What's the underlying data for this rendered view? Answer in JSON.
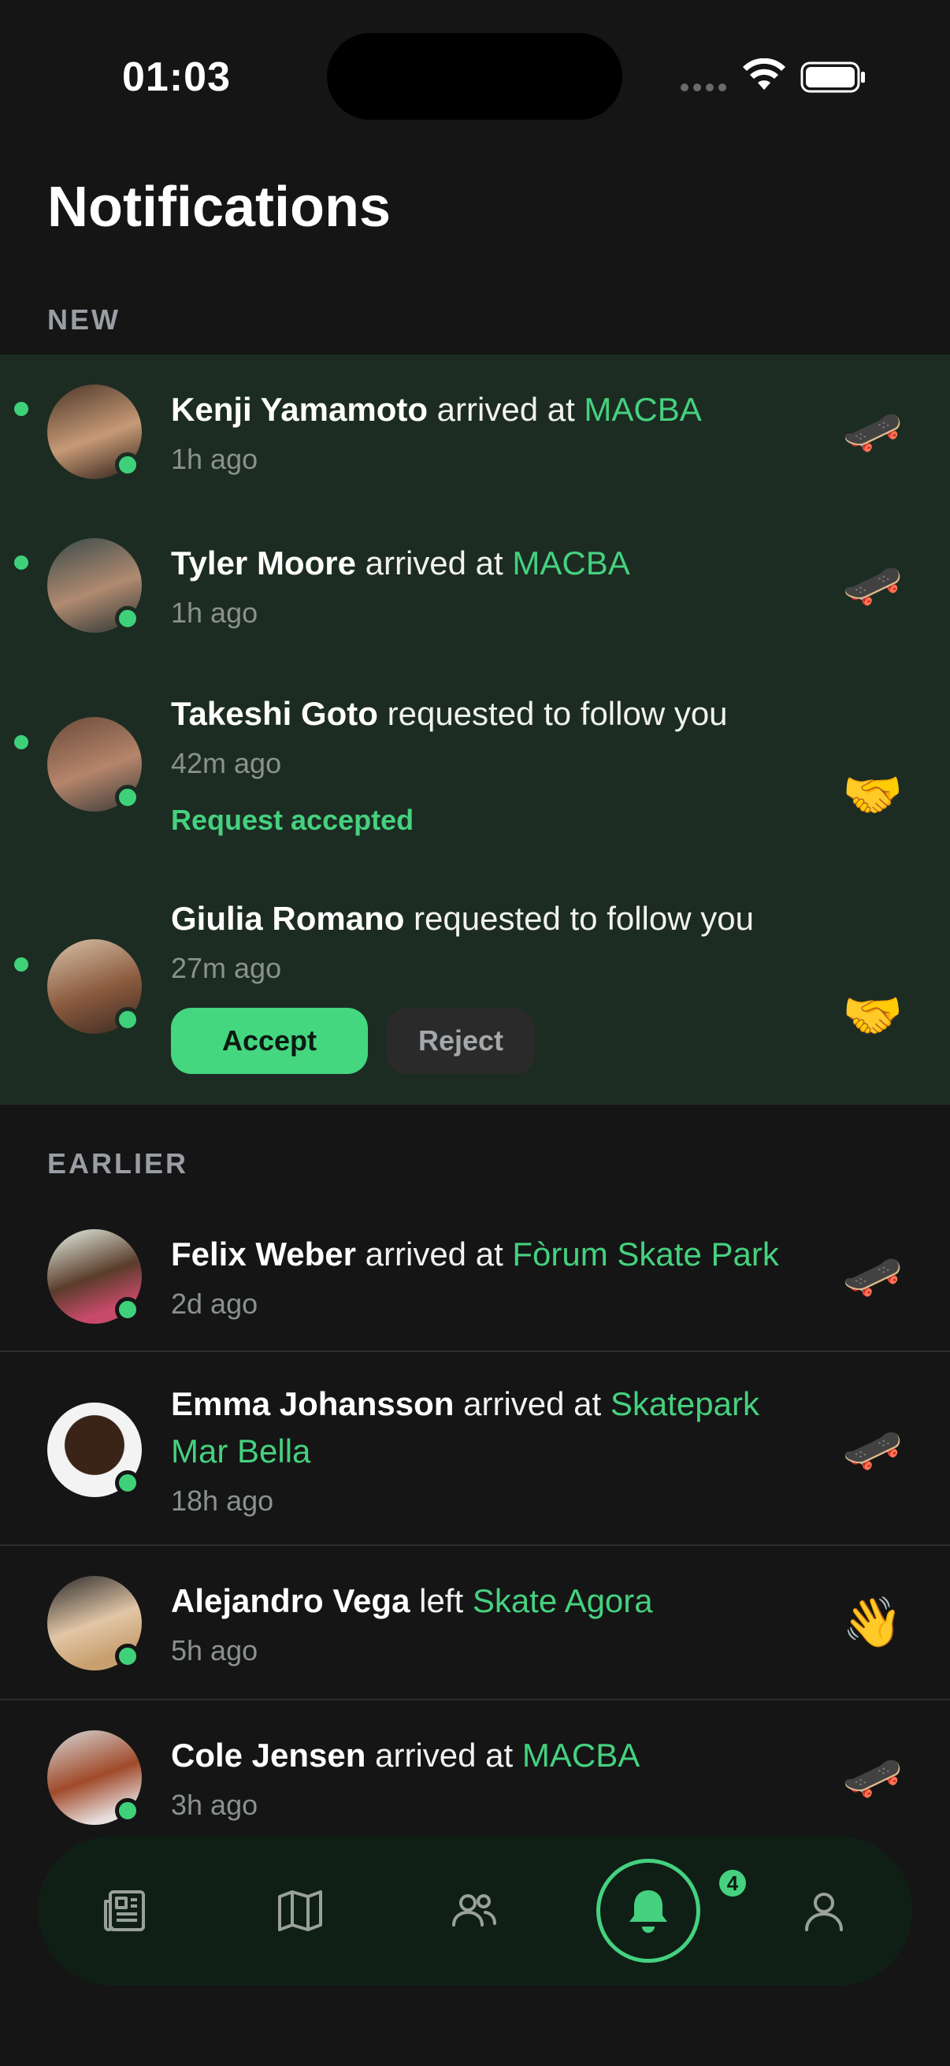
{
  "status_bar": {
    "time": "01:03"
  },
  "page": {
    "title": "Notifications"
  },
  "sections": {
    "new_label": "NEW",
    "earlier_label": "EARLIER"
  },
  "new_notifications": [
    {
      "name": "Kenji Yamamoto",
      "action": "arrived at",
      "place": "MACBA",
      "time": "1h ago",
      "icon": "skateboard-icon",
      "emoji": "🛹"
    },
    {
      "name": "Tyler Moore",
      "action": "arrived at",
      "place": "MACBA",
      "time": "1h ago",
      "icon": "skateboard-icon",
      "emoji": "🛹"
    },
    {
      "name": "Takeshi Goto",
      "action": "requested to follow you",
      "time": "42m ago",
      "status": "Request accepted",
      "icon": "handshake-icon",
      "emoji": "🤝"
    },
    {
      "name": "Giulia Romano",
      "action": "requested to follow you",
      "time": "27m ago",
      "accept_label": "Accept",
      "reject_label": "Reject",
      "icon": "handshake-icon",
      "emoji": "🤝"
    }
  ],
  "earlier_notifications": [
    {
      "name": "Felix Weber",
      "action": "arrived at",
      "place": "Fòrum Skate Park",
      "time": "2d ago",
      "icon": "skateboard-icon",
      "emoji": "🛹"
    },
    {
      "name": "Emma Johansson",
      "action": "arrived at",
      "place": "Skatepark Mar Bella",
      "time": "18h ago",
      "icon": "skateboard-icon",
      "emoji": "🛹"
    },
    {
      "name": "Alejandro Vega",
      "action": "left",
      "place": "Skate Agora",
      "time": "5h ago",
      "icon": "waving-hand-icon",
      "emoji": "👋"
    },
    {
      "name": "Cole Jensen",
      "action": "arrived at",
      "place": "MACBA",
      "time": "3h ago",
      "icon": "skateboard-icon",
      "emoji": "🛹"
    }
  ],
  "tab_bar": {
    "tabs": [
      "feed-icon",
      "map-icon",
      "friends-icon",
      "bell-icon",
      "profile-icon"
    ],
    "active": "bell-icon",
    "badge_count": "4"
  },
  "colors": {
    "accent": "#45d17f",
    "background": "#151515",
    "new_section_bg": "#1c2c22"
  }
}
